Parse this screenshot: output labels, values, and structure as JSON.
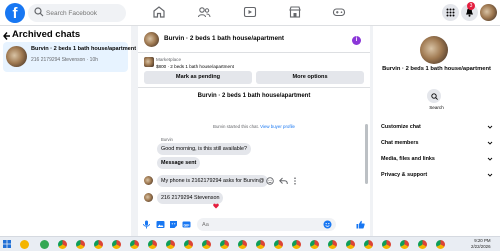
{
  "topbar": {
    "search_placeholder": "Search Facebook",
    "notification_count": "3"
  },
  "left": {
    "title": "Archived chats",
    "chats": [
      {
        "title": "Burvin · 2 beds 1 bath house/apartment",
        "subtitle": "216 2179294 Stevenson · 10h"
      }
    ]
  },
  "conversation": {
    "header_title": "Burvin · 2 beds 1 bath house/apartment",
    "marketplace_label": "Marketplace",
    "listing_line": "$800 · 2 beds 1 bath house/apartment",
    "mark_pending_label": "Mark as pending",
    "more_options_label": "More options",
    "listing_title": "Burvin · 2 beds 1 bath house/apartment",
    "system_message": "Burvin started this chat.",
    "system_link": "View buyer profile",
    "sender_name": "Burvin",
    "messages": [
      {
        "text": "Good morning, is this still available?"
      },
      {
        "text": "Message sent"
      },
      {
        "text": "My phone is 2162179294 asks for Burvin@"
      },
      {
        "text": "216 2179294 Stevenson"
      }
    ],
    "composer_placeholder": "Aa"
  },
  "right": {
    "title": "Burvin · 2 beds 1 bath house/apartment",
    "search_label": "Search",
    "menu": [
      {
        "label": "Customize chat"
      },
      {
        "label": "Chat members"
      },
      {
        "label": "Media, files and links"
      },
      {
        "label": "Privacy & support"
      }
    ]
  },
  "taskbar": {
    "time": "9:20 PM",
    "date": "2/22/2026"
  },
  "colors": {
    "brand": "#1877f2",
    "badge": "#e41e3f",
    "info_purple": "#8b37d8"
  }
}
